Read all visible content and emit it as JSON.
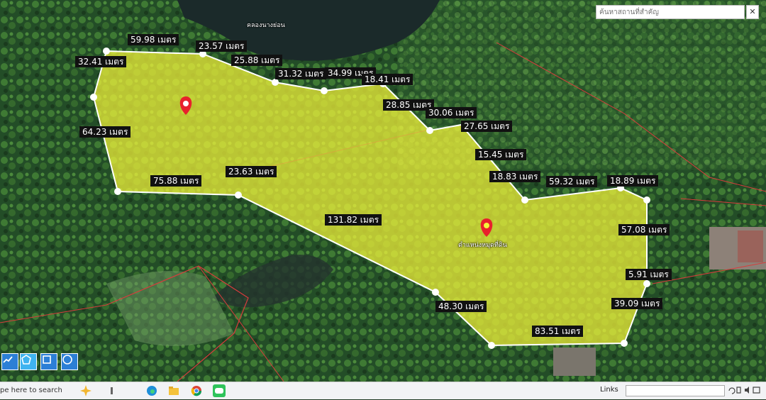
{
  "search": {
    "placeholder": "ค้นหาสถานที่สำคัญ",
    "close_label": "✕"
  },
  "map": {
    "place_labels": [
      "คลองนางย่อน",
      "ตำแหน่งหมุดที่ดิน"
    ],
    "distances": [
      "59.98 เมตร",
      "23.57 เมตร",
      "32.41 เมตร",
      "25.88 เมตร",
      "31.32 เมตร",
      "34.99 เมตร",
      "18.41 เมตร",
      "28.85 เมตร",
      "30.06 เมตร",
      "64.23 เมตร",
      "27.65 เมตร",
      "15.45 เมตร",
      "23.63 เมตร",
      "18.83 เมตร",
      "75.88 เมตร",
      "59.32 เมตร",
      "18.89 เมตร",
      "131.82 เมตร",
      "57.08 เมตร",
      "5.91 เมตร",
      "39.09 เมตร",
      "48.30 เมตร",
      "83.51 เมตร"
    ],
    "polygon_color": "#f5f53a",
    "marker_color": "#e8212c"
  },
  "toolbar": {
    "tools": [
      "freehand-tool-icon",
      "polygon-tool-icon",
      "rectangle-tool-icon",
      "circle-tool-icon"
    ]
  },
  "taskbar": {
    "search_text": "pe here to search",
    "links_label": "Links",
    "icons": [
      "copilot-icon",
      "task-view-icon",
      "edge-icon",
      "file-explorer-icon",
      "chrome-icon",
      "line-icon"
    ]
  }
}
